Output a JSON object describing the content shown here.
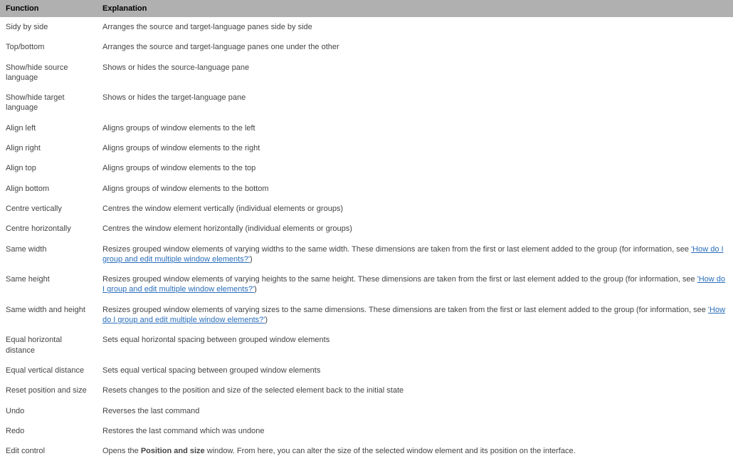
{
  "headers": {
    "function": "Function",
    "explanation": "Explanation"
  },
  "link_text": "'How do I group and edit multiple window elements?'",
  "rows": [
    {
      "func": "Sidy by side",
      "exp": "Arranges the source and target-language panes side by side"
    },
    {
      "func": "Top/bottom",
      "exp": "Arranges the source and target-language panes one under the other"
    },
    {
      "func": "Show/hide source language",
      "exp": "Shows or hides the source-language pane"
    },
    {
      "func": "Show/hide target language",
      "exp": "Shows or hides the target-language pane"
    },
    {
      "func": "Align left",
      "exp": "Aligns groups of window elements to the left"
    },
    {
      "func": "Align right",
      "exp": "Aligns groups of window elements to the right"
    },
    {
      "func": "Align top",
      "exp": "Aligns groups of window elements to the top"
    },
    {
      "func": "Align bottom",
      "exp": "Aligns groups of window elements to the bottom"
    },
    {
      "func": "Centre vertically",
      "exp": "Centres the window element vertically (individual elements or groups)"
    },
    {
      "func": "Centre horizontally",
      "exp": "Centres the window element horizontally (individual elements or groups)"
    },
    {
      "func": "Same width",
      "exp_prefix": "Resizes grouped window elements of varying widths to the same width. These dimensions are taken from the first or last element added to the group (for information, see ",
      "has_link": true,
      "exp_suffix": ")"
    },
    {
      "func": "Same height",
      "exp_prefix": "Resizes grouped window elements of varying heights to the same height. These dimensions are taken from the first or last element added to the group (for information, see ",
      "has_link": true,
      "exp_suffix": ")"
    },
    {
      "func": "Same width and height",
      "exp_prefix": "Resizes grouped window elements of varying sizes to the same dimensions. These dimensions are taken from the first or last element added to the group (for information, see ",
      "has_link": true,
      "exp_suffix": ")"
    },
    {
      "func": "Equal horizontal distance",
      "exp": "Sets equal horizontal spacing between grouped window elements"
    },
    {
      "func": "Equal vertical distance",
      "exp": "Sets equal vertical spacing between grouped window elements"
    },
    {
      "func": "Reset position and size",
      "exp": "Resets changes to the position and size of the selected element back to the initial state"
    },
    {
      "func": "Undo",
      "exp": "Reverses the last command"
    },
    {
      "func": "Redo",
      "exp": "Restores the last command which was undone"
    },
    {
      "func": "Edit control",
      "exp_prefix": "Opens the ",
      "bold": "Position and size",
      "exp_suffix": " window. From here, you can alter the size of the selected window element and its position on the interface."
    }
  ]
}
